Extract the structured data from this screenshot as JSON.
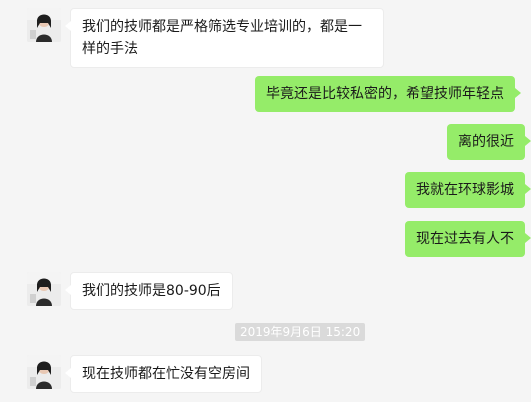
{
  "messages": [
    {
      "side": "in",
      "text": "我们的技师都是严格筛选专业培训的，都是一样的手法"
    },
    {
      "side": "out",
      "text": "毕竟还是比较私密的，希望技师年轻点"
    },
    {
      "side": "out",
      "text": "离的很近"
    },
    {
      "side": "out",
      "text": "我就在环球影城"
    },
    {
      "side": "out",
      "text": "现在过去有人不"
    },
    {
      "side": "in",
      "text": "我们的技师是80-90后"
    },
    {
      "side": "in",
      "text": "现在技师都在忙没有空房间"
    }
  ],
  "timestamp": "2019年9月6日 15:20",
  "colors": {
    "background": "#f5f5f5",
    "incoming_bubble": "#ffffff",
    "outgoing_bubble": "#95ec69",
    "timestamp_bg": "#dadada"
  }
}
